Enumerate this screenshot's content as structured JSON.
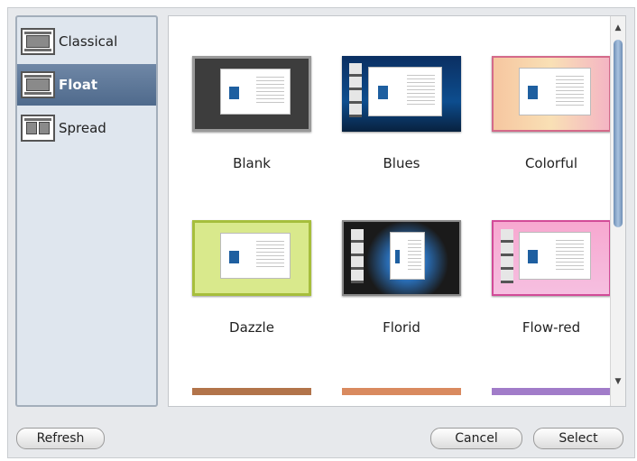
{
  "sidebar": {
    "items": [
      {
        "label": "Classical",
        "icon": "classical-layout-icon",
        "selected": false
      },
      {
        "label": "Float",
        "icon": "float-layout-icon",
        "selected": true
      },
      {
        "label": "Spread",
        "icon": "spread-layout-icon",
        "selected": false
      }
    ]
  },
  "templates": [
    {
      "label": "Blank"
    },
    {
      "label": "Blues"
    },
    {
      "label": "Colorful"
    },
    {
      "label": "Dazzle"
    },
    {
      "label": "Florid"
    },
    {
      "label": "Flow-red"
    }
  ],
  "footer": {
    "refresh_label": "Refresh",
    "cancel_label": "Cancel",
    "select_label": "Select"
  },
  "colors": {
    "selected_item": "#5a7496",
    "scroll_thumb": "#8aa6c8"
  }
}
